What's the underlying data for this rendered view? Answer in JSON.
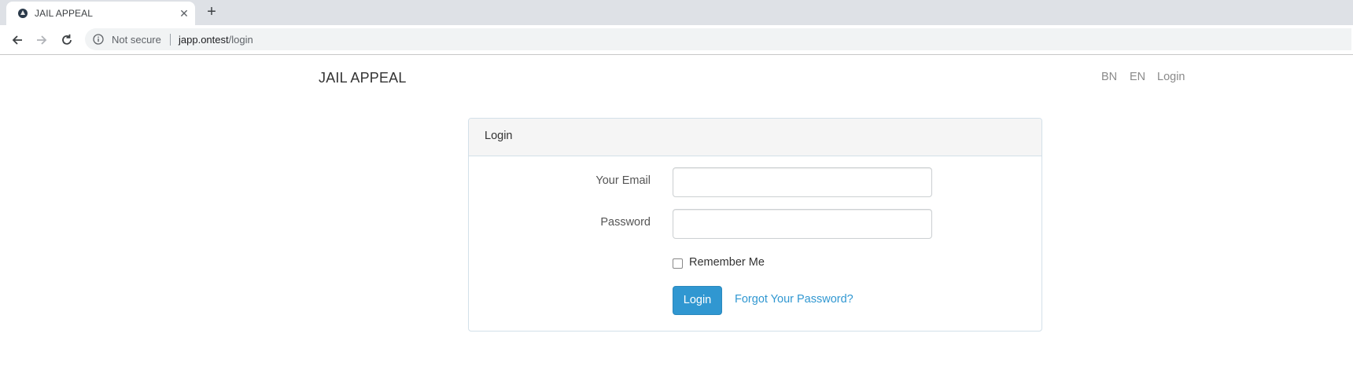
{
  "browser": {
    "tab_title": "JAIL APPEAL",
    "close_glyph": "✕",
    "new_tab_glyph": "+",
    "security_text": "Not secure",
    "url_host": "japp.ontest",
    "url_path": "/login"
  },
  "nav": {
    "brand": "JAIL APPEAL",
    "links": [
      "BN",
      "EN",
      "Login"
    ]
  },
  "login_panel": {
    "heading": "Login",
    "email_label": "Your Email",
    "email_value": "",
    "password_label": "Password",
    "password_value": "",
    "remember_label": "Remember Me",
    "remember_checked": false,
    "submit_label": "Login",
    "forgot_link": "Forgot Your Password?"
  },
  "colors": {
    "primary": "#3097d1",
    "panel_border": "#d3e0e9",
    "panel_heading_bg": "#f5f5f5",
    "tabbar_bg": "#dee1e6"
  }
}
